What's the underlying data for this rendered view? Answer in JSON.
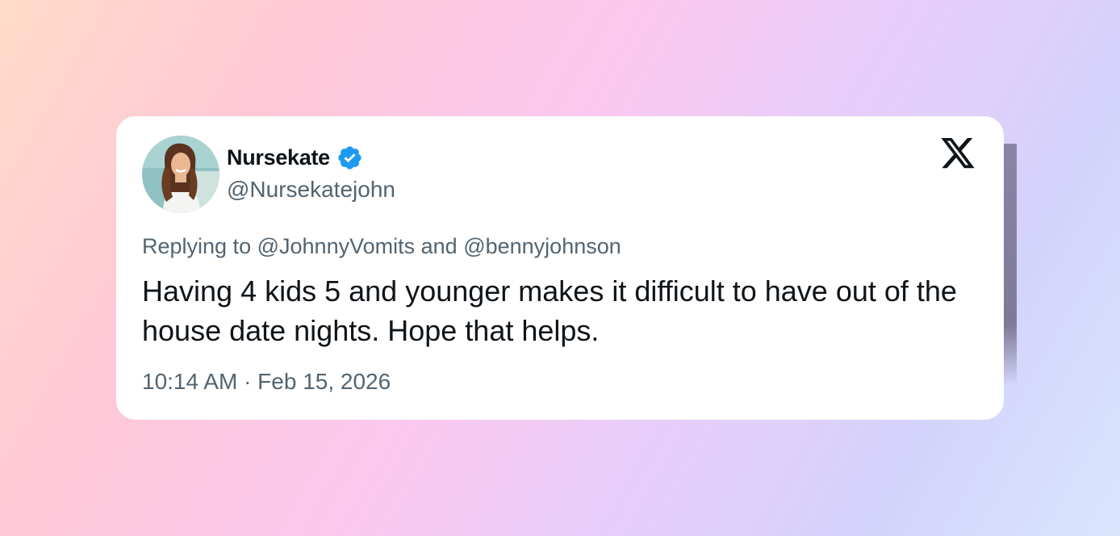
{
  "tweet": {
    "display_name": "Nursekate",
    "handle": "@Nursekatejohn",
    "verified": true,
    "verified_icon": "verified-badge-icon",
    "avatar_icon": "profile-photo",
    "platform_icon": "x-logo-icon",
    "replying_prefix": "Replying to",
    "reply_to_1": "@JohnnyVomits",
    "reply_joiner": "and",
    "reply_to_2": "@bennyjohnson",
    "text": "Having 4 kids 5 and younger makes it difficult to have out of the house date nights. Hope that helps.",
    "timestamp": "10:14 AM · Feb 15, 2026"
  },
  "colors": {
    "name": "#0f1419",
    "secondary": "#536471",
    "verified": "#1d9bf0",
    "card": "#ffffff"
  }
}
